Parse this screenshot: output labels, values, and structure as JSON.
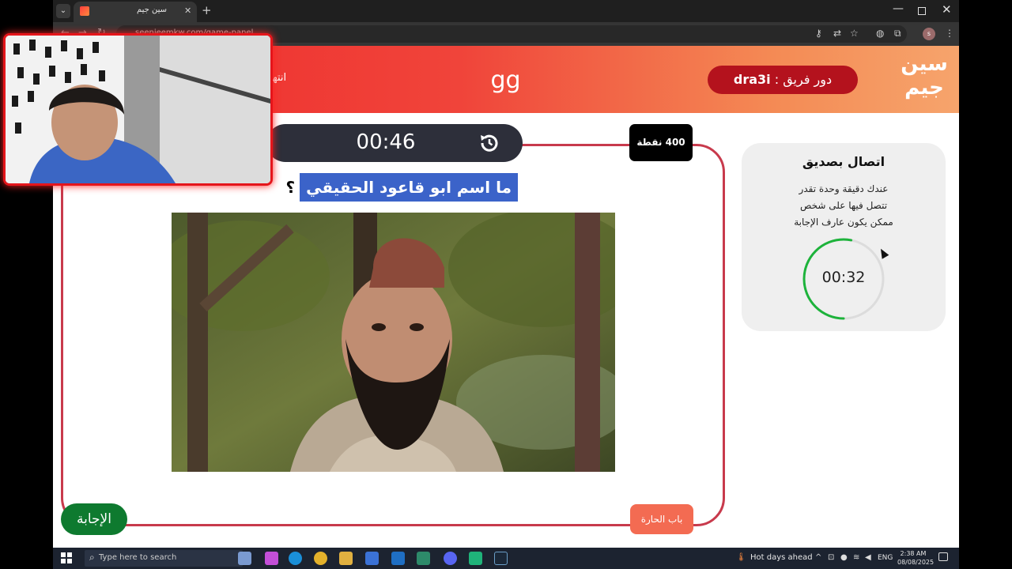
{
  "browser": {
    "tab_title": "سين جيم",
    "new_tab_label": "+",
    "close_tab_label": "✕",
    "url": "seenjeemkw.com/game-panel",
    "window_min": "—",
    "window_close": "✕",
    "profile_letter": "s"
  },
  "header": {
    "logo_line1": "سين",
    "logo_line2": "جيم",
    "team_label": "دور فريق :",
    "team_name": "dra3i",
    "game_name": "gg",
    "end_game_label": "انتها"
  },
  "question": {
    "timer": "00:46",
    "points": "400 نقطة",
    "text": "ما اسم ابو قاعود الحقيقي",
    "question_mark": "؟",
    "answer_button": "الإجابة",
    "category": "باب الحارة"
  },
  "lifeline": {
    "title": "اتصال بصديق",
    "desc_line1": "عندك دقيقة وحدة تقدر",
    "desc_line2": "تتصل فيها على شخص",
    "desc_line3": "ممكن يكون عارف الإجابة",
    "timer": "00:32",
    "progress_fraction": 0.53
  },
  "taskbar": {
    "search_placeholder": "Type here to search",
    "weather": "Hot days ahead",
    "language": "ENG",
    "time": "2:38 AM",
    "date": "08/08/2025"
  },
  "colors": {
    "header_start": "#ee2a2c",
    "header_end": "#f6a46c",
    "team_pill": "#b4121d",
    "card_border": "#c83a4c",
    "answer_button": "#0e7a2f",
    "category_chip": "#f36b52",
    "question_highlight": "#3b63c9",
    "ring_progress": "#1db33b"
  }
}
